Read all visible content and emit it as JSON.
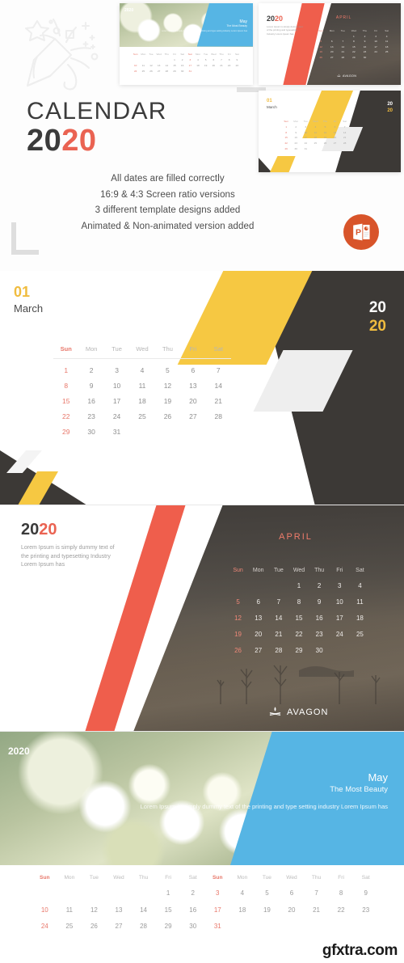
{
  "hero": {
    "icon": "party-popper-icon",
    "title": "CALENDAR",
    "year_dark": "20",
    "year_accent": "20",
    "features": [
      "All dates are filled correctly",
      "16:9 & 4:3 Screen ratio versions",
      "3 different template designs added",
      "Animated & Non-animated version added"
    ],
    "badge_icon": "powerpoint-icon"
  },
  "colors": {
    "accent_red": "#ea6352",
    "accent_yellow": "#f0bc3f",
    "accent_blue": "#56b5e4",
    "dark": "#3c3936",
    "ppt_orange": "#d8542a"
  },
  "weekday_headers": [
    "Sun",
    "Mon",
    "Tue",
    "Wed",
    "Thu",
    "Fri",
    "Sat"
  ],
  "weekday_headers_wide": [
    "Sun",
    "Mon",
    "Tue",
    "Wed",
    "Thu",
    "Fri",
    "Sat",
    "Sun",
    "Mon",
    "Tue",
    "Wed",
    "Thu",
    "Fri",
    "Sat"
  ],
  "thumbnails": [
    {
      "name": "thumb-may",
      "year": "2020",
      "month": "May",
      "subtitle": "The Most Beauty",
      "paragraph": "Lorem Ipsum is simply dummy text of the printing and type setting industry Lorem Ipsum has"
    },
    {
      "name": "thumb-april",
      "year_dark": "20",
      "year_accent": "20",
      "month": "APRIL",
      "paragraph": "Lorem Ipsum is simply dummy text of the printing and typesetting Industry Lorem Ipsum has",
      "logo": "AVAGON"
    },
    {
      "name": "thumb-march",
      "number": "01",
      "month": "March",
      "year_top": "20",
      "year_bottom": "20"
    }
  ],
  "march_panel": {
    "number": "01",
    "month": "March",
    "year_white": "20",
    "year_yellow": "20",
    "days": [
      [
        "1",
        "2",
        "3",
        "4",
        "5",
        "6",
        "7"
      ],
      [
        "8",
        "9",
        "10",
        "11",
        "12",
        "13",
        "14"
      ],
      [
        "15",
        "16",
        "17",
        "18",
        "19",
        "20",
        "21"
      ],
      [
        "22",
        "23",
        "24",
        "25",
        "26",
        "27",
        "28"
      ],
      [
        "29",
        "30",
        "31",
        "",
        "",
        "",
        ""
      ]
    ]
  },
  "april_panel": {
    "year_dark": "20",
    "year_accent": "20",
    "paragraph": "Lorem Ipsum is simply dummy text of the printing and typesetting Industry Lorem Ipsum has",
    "month": "APRIL",
    "logo": "AVAGON",
    "days": [
      [
        "",
        "",
        "",
        "1",
        "2",
        "3",
        "4"
      ],
      [
        "5",
        "6",
        "7",
        "8",
        "9",
        "10",
        "11"
      ],
      [
        "12",
        "13",
        "14",
        "15",
        "16",
        "17",
        "18"
      ],
      [
        "19",
        "20",
        "21",
        "22",
        "23",
        "24",
        "25"
      ],
      [
        "26",
        "27",
        "28",
        "29",
        "30",
        "",
        ""
      ]
    ]
  },
  "may_panel": {
    "year": "2020",
    "month": "May",
    "subtitle": "The Most Beauty",
    "paragraph": "Lorem Ipsum is simply dummy text of the printing and type setting industry Lorem Ipsum has"
  },
  "may_wide_grid": {
    "days": [
      [
        "",
        "",
        "",
        "",
        "",
        "1",
        "2",
        "3",
        "4",
        "5",
        "6",
        "7",
        "8",
        "9"
      ],
      [
        "10",
        "11",
        "12",
        "13",
        "14",
        "15",
        "16",
        "17",
        "18",
        "19",
        "20",
        "21",
        "22",
        "23"
      ],
      [
        "24",
        "25",
        "26",
        "27",
        "28",
        "29",
        "30",
        "31",
        "",
        "",
        "",
        "",
        "",
        ""
      ]
    ]
  },
  "watermark": "gfxtra.com"
}
